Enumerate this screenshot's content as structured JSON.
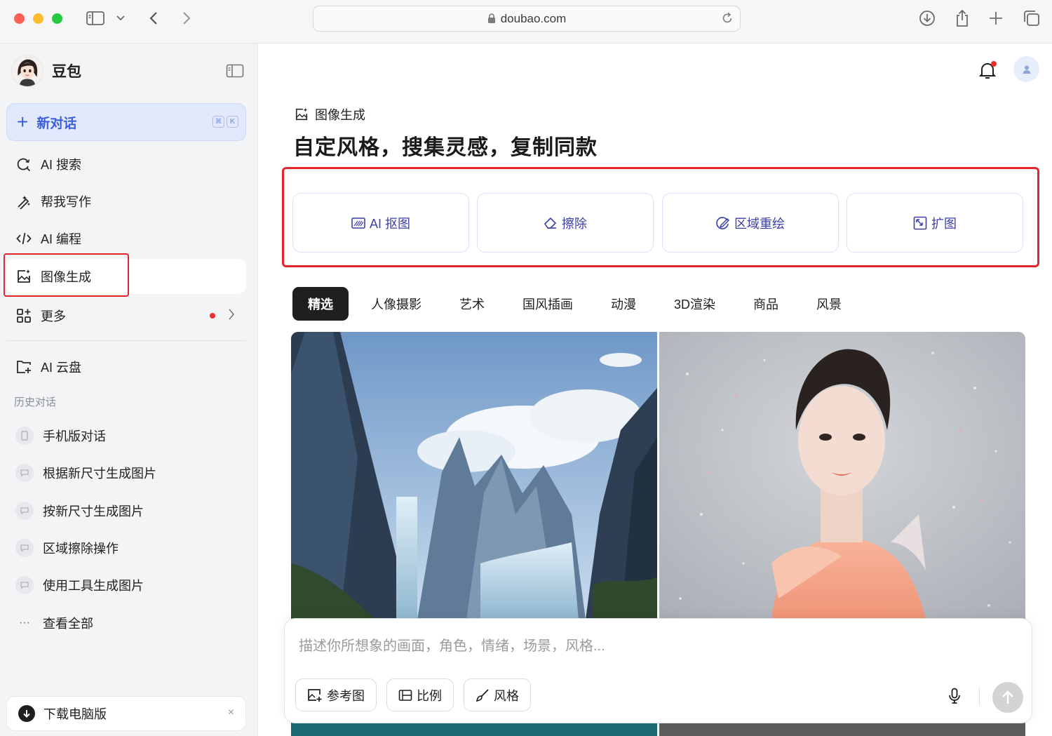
{
  "browser": {
    "url": "doubao.com"
  },
  "sidebar": {
    "brand_name": "豆包",
    "new_chat_label": "新对话",
    "shortcut_keys": [
      "⌘",
      "K"
    ],
    "nav": [
      {
        "label": "AI 搜索",
        "icon": "search-refresh-icon"
      },
      {
        "label": "帮我写作",
        "icon": "pen-sparkle-icon"
      },
      {
        "label": "AI 编程",
        "icon": "code-icon"
      },
      {
        "label": "图像生成",
        "icon": "image-sparkle-icon",
        "active": true
      },
      {
        "label": "更多",
        "icon": "apps-icon"
      }
    ],
    "cloud_label": "AI 云盘",
    "history_title": "历史对话",
    "history": [
      {
        "label": "手机版对话",
        "icon": "phone-icon"
      },
      {
        "label": "根据新尺寸生成图片",
        "icon": "chat-bubble-icon"
      },
      {
        "label": "按新尺寸生成图片",
        "icon": "chat-bubble-icon"
      },
      {
        "label": "区域擦除操作",
        "icon": "chat-bubble-icon"
      },
      {
        "label": "使用工具生成图片",
        "icon": "chat-bubble-icon"
      },
      {
        "label": "查看全部",
        "icon": "ellipsis-icon"
      }
    ],
    "download_label": "下载电脑版",
    "close_glyph": "×"
  },
  "main": {
    "section_tag": "图像生成",
    "headline": "自定风格，搜集灵感，复制同款",
    "tools": [
      {
        "label": "AI 抠图",
        "icon": "cutout-icon"
      },
      {
        "label": "擦除",
        "icon": "eraser-icon"
      },
      {
        "label": "区域重绘",
        "icon": "redraw-icon"
      },
      {
        "label": "扩图",
        "icon": "expand-icon"
      }
    ],
    "tabs": [
      "精选",
      "人像摄影",
      "艺术",
      "国风插画",
      "动漫",
      "3D渲染",
      "商品",
      "风景"
    ],
    "active_tab": "精选",
    "composer": {
      "placeholder": "描述你所想象的画面，角色，情绪，场景，风格...",
      "chips": [
        {
          "label": "参考图",
          "icon": "image-plus-icon"
        },
        {
          "label": "比例",
          "icon": "ratio-icon"
        },
        {
          "label": "风格",
          "icon": "brush-icon"
        }
      ]
    }
  },
  "colors": {
    "accent": "#3b5fd8",
    "highlight": "#e4262c",
    "tool_text": "#3b3fa8"
  }
}
